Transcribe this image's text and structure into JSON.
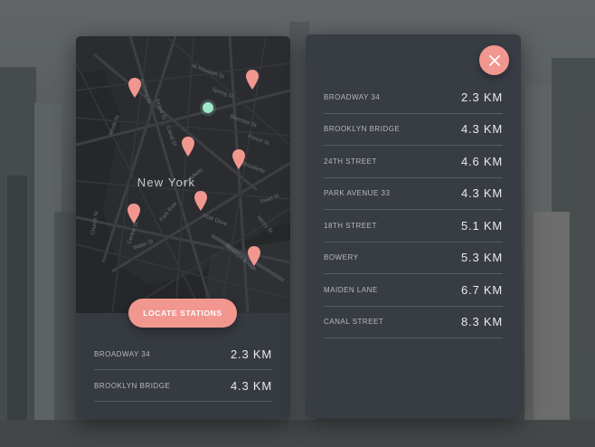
{
  "map": {
    "city_label": "New York",
    "street_labels": [
      "W Houston St",
      "Spring St",
      "Bleecker St",
      "Prince St",
      "Broome St",
      "Grand St",
      "Canal St",
      "E Broadway",
      "Worth St",
      "Pearl St",
      "Centre St",
      "FDR Drive",
      "Church St",
      "Broadway",
      "Brooklyn Bridge",
      "Water St",
      "Park Row",
      "Henry St"
    ]
  },
  "locate_button": {
    "label": "LOCATE STATIONS"
  },
  "left_list": [
    {
      "name": "BROADWAY 34",
      "distance": "2.3 KM"
    },
    {
      "name": "BROOKLYN BRIDGE",
      "distance": "4.3 KM"
    }
  ],
  "right_list": [
    {
      "name": "BROADWAY 34",
      "distance": "2.3 KM"
    },
    {
      "name": "BROOKLYN BRIDGE",
      "distance": "4.3 KM"
    },
    {
      "name": "24TH STREET",
      "distance": "4.6 KM"
    },
    {
      "name": "PARK AVENUE 33",
      "distance": "4.3 KM"
    },
    {
      "name": "18TH STREET",
      "distance": "5.1 KM"
    },
    {
      "name": "BOWERY",
      "distance": "5.3 KM"
    },
    {
      "name": "MAIDEN LANE",
      "distance": "6.7 KM"
    },
    {
      "name": "CANAL STREET",
      "distance": "8.3 KM"
    }
  ],
  "colors": {
    "accent": "#f2978f",
    "user_location": "#9ee8c8",
    "card": "#363a41"
  }
}
